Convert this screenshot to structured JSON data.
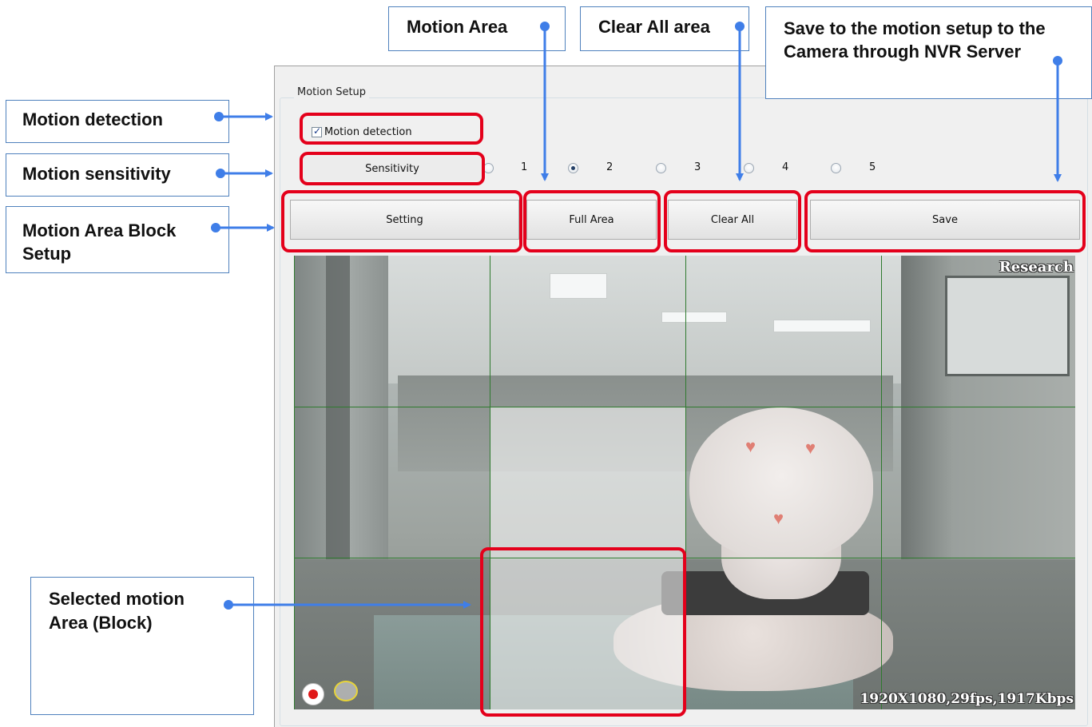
{
  "panel": {
    "group_title": "Motion Setup",
    "motion_detection": {
      "label": "Motion detection",
      "checked": true
    },
    "sensitivity": {
      "label": "Sensitivity",
      "options": [
        "1",
        "2",
        "3",
        "4",
        "5"
      ],
      "selected": "2"
    },
    "buttons": {
      "setting": "Setting",
      "full_area": "Full Area",
      "clear_all": "Clear All",
      "save": "Save"
    }
  },
  "camera": {
    "name": "Research",
    "stats": "1920X1080,29fps,1917Kbps",
    "grid": {
      "columns": 4,
      "rows": 3
    },
    "selected_blocks": [
      {
        "row": 1,
        "col": 1
      },
      {
        "row": 2,
        "col": 1
      }
    ]
  },
  "callouts": {
    "motion_area": "Motion Area",
    "clear_all_area": "Clear All area",
    "save_setup": "Save to the motion setup to the Camera through NVR Server",
    "motion_detection": "Motion detection",
    "motion_sensitivity": "Motion sensitivity",
    "block_setup": "Motion Area Block Setup",
    "selected_area": "Selected motion Area (Block)"
  },
  "colors": {
    "highlight": "#e4001b",
    "callout_border": "#4f81bd",
    "arrow": "#3f7ee8",
    "grid_line": "#2f7a2f"
  }
}
